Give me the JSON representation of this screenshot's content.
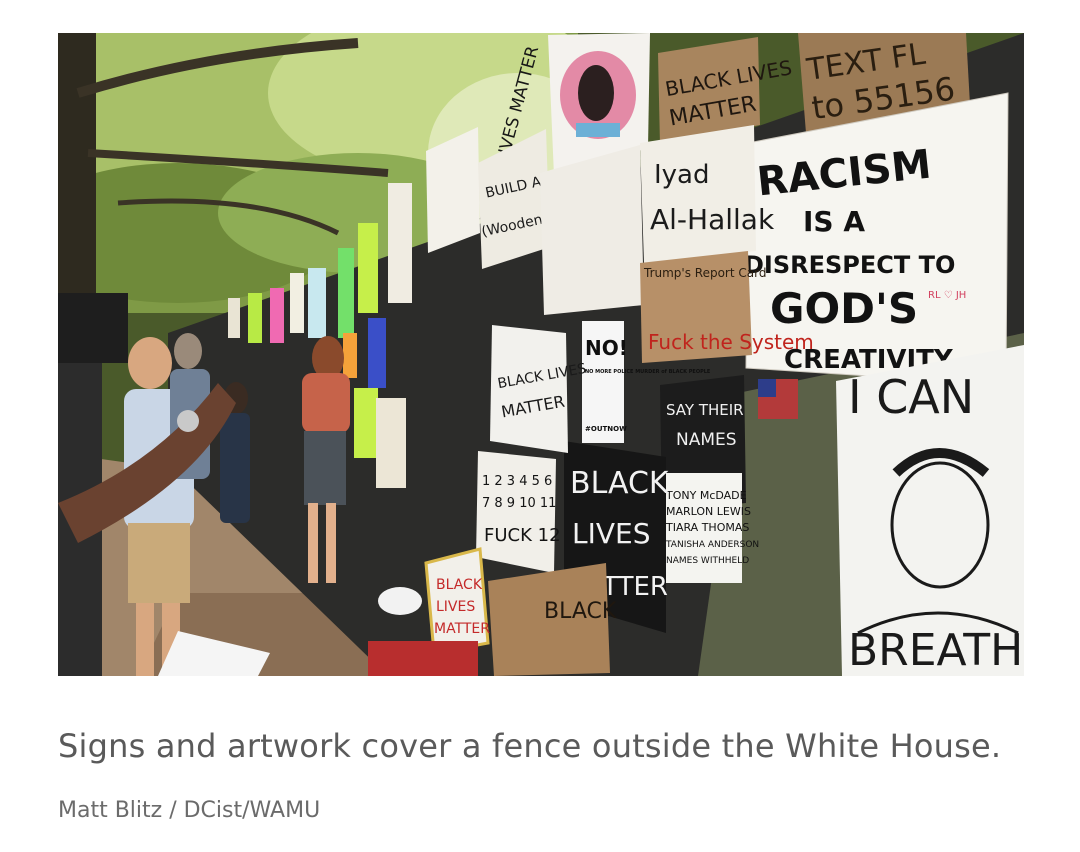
{
  "article": {
    "caption": "Signs and artwork cover a fence outside the White House.",
    "credit": "Matt Blitz / DCist/WAMU"
  },
  "photo": {
    "signs": {
      "racism_line1": "RACISM",
      "racism_line2": "IS  A",
      "racism_line3": "DISRESPECT TO",
      "racism_line4": "GOD'S",
      "racism_line5": "CREATIVITY",
      "racism_initials": "RL ♡ JH",
      "text_to_line1": "TEXT FL",
      "text_to_line2": "to 55156",
      "blm_top_line1": "BLACK LIVES",
      "blm_top_line2": "MATTER",
      "iyad_line1": "Iyad",
      "iyad_line2": "Al-Hallak",
      "blm_vertical": "BLACK LIVES MATTER",
      "build_wall_line1": "BUILD A",
      "build_wall_line2": "(Wooden) WALL",
      "report_card": "Trump's Report Card",
      "system": "Fuck the System",
      "no": "NO!",
      "no_body": "NO MORE POLICE MURDER of BLACK PEOPLE",
      "no_footer": "#OUTNOW",
      "say_names_line1": "SAY THEIR",
      "say_names_line2": "NAMES",
      "names_line1": "TONY McDADE",
      "names_line2": "MARLON LEWIS",
      "names_line3": "TIARA THOMAS",
      "names_line4": "TANISHA ANDERSON",
      "names_line5": "NAMES WITHHELD",
      "blm_big_line1": "BLACK",
      "blm_big_line2": "LIVES",
      "blm_big_line3": "MATTER",
      "blm_mid_line1": "BLACK LIVES",
      "blm_mid_line2": "MATTER",
      "count_line1": "1 2 3 4 5 6",
      "count_line2": "7 8 9 10 11",
      "count_line3": "FUCK 12",
      "blm_ground_line1": "BLACK",
      "blm_ground_line2": "LIVES",
      "blm_ground_line3": "MATTER",
      "black_cardboard": "BLACK",
      "i_cant_line1": "I CAN",
      "i_cant_line2": "BREATH"
    }
  }
}
